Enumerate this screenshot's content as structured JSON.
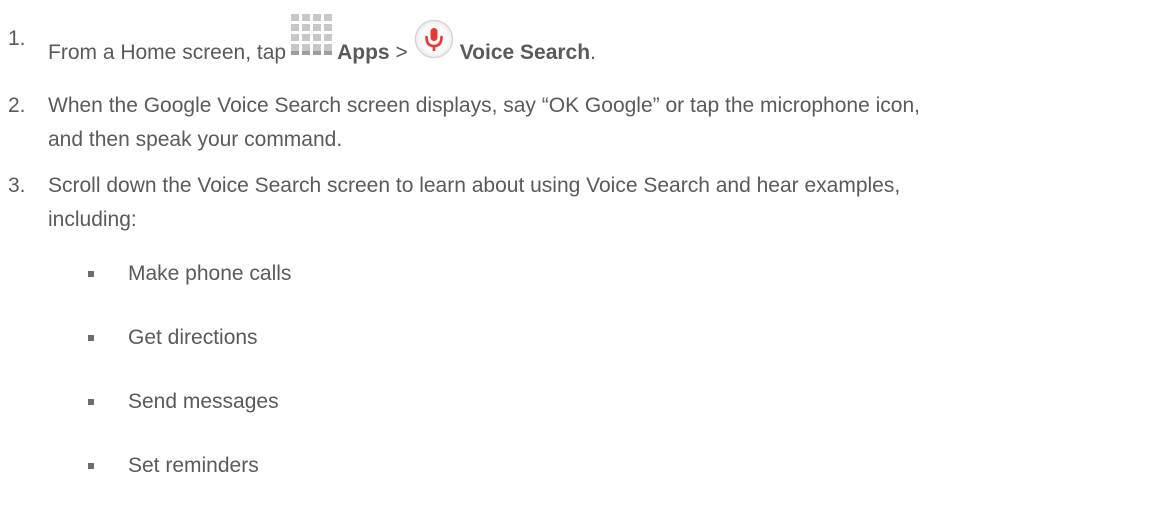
{
  "steps": [
    {
      "number": "1.",
      "text_before": "From a Home screen, tap",
      "apps_label": "Apps",
      "separator": ">",
      "voice_label": "Voice Search",
      "period": "."
    },
    {
      "number": "2.",
      "line1": "When the Google Voice Search screen displays, say “OK Google” or tap the microphone icon,",
      "line2": "and then speak your command."
    },
    {
      "number": "3.",
      "line1": "Scroll down the Voice Search screen to learn about using Voice Search and hear examples,",
      "line2": "including:"
    }
  ],
  "examples": [
    "Make phone calls",
    "Get directions",
    "Send messages",
    "Set reminders"
  ],
  "icons": {
    "apps": "apps-grid-icon",
    "voice": "microphone-icon"
  },
  "colors": {
    "text": "#5a5a5a",
    "mic_red": "#e53935",
    "grid_gray": "#c7c7c7"
  }
}
